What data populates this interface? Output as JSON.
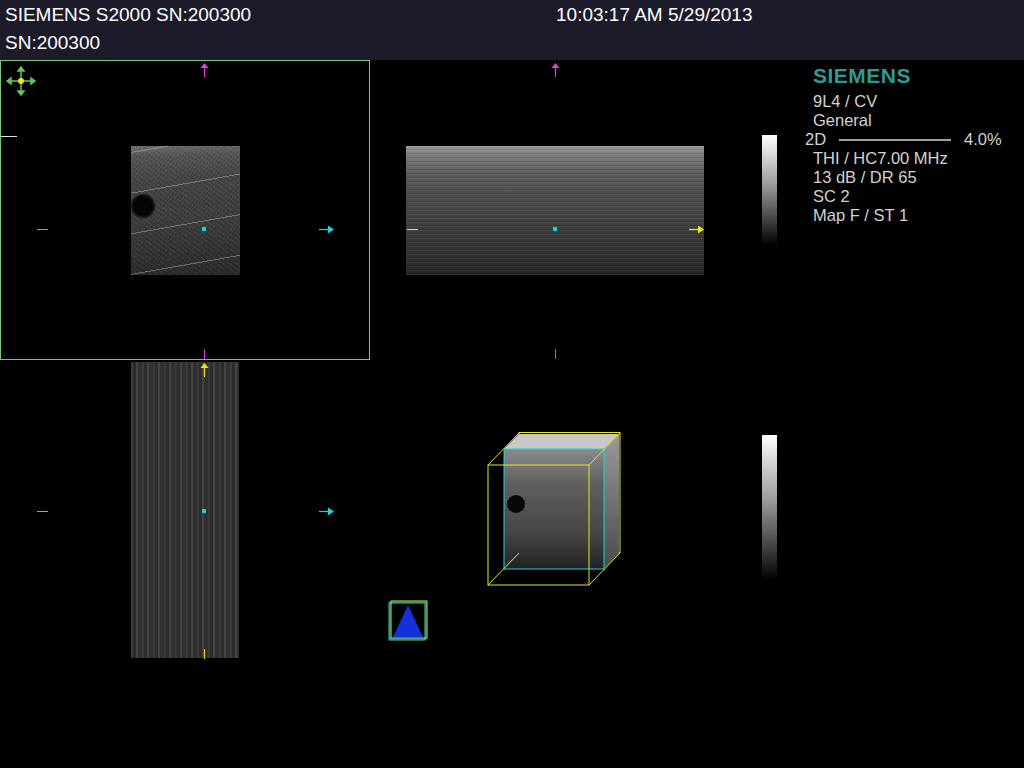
{
  "header": {
    "system": "SIEMENS S2000 SN:200300",
    "timestamp": "10:03:17 AM 5/29/2013",
    "serial": "SN:200300"
  },
  "views": [
    {
      "kind": "plane-a",
      "selected": true
    },
    {
      "kind": "plane-b",
      "selected": false
    },
    {
      "kind": "plane-c",
      "selected": false
    },
    {
      "kind": "volume",
      "selected": false
    }
  ],
  "info_panel": {
    "logo": "SIEMENS",
    "transducer": "9L4 / CV",
    "preset": "General",
    "mode": {
      "label": "2D",
      "value": "4.0%"
    },
    "settings": [
      "THI / HC7.00 MHz",
      "13 dB / DR 65",
      "SC 2",
      "Map F / ST 1"
    ]
  }
}
